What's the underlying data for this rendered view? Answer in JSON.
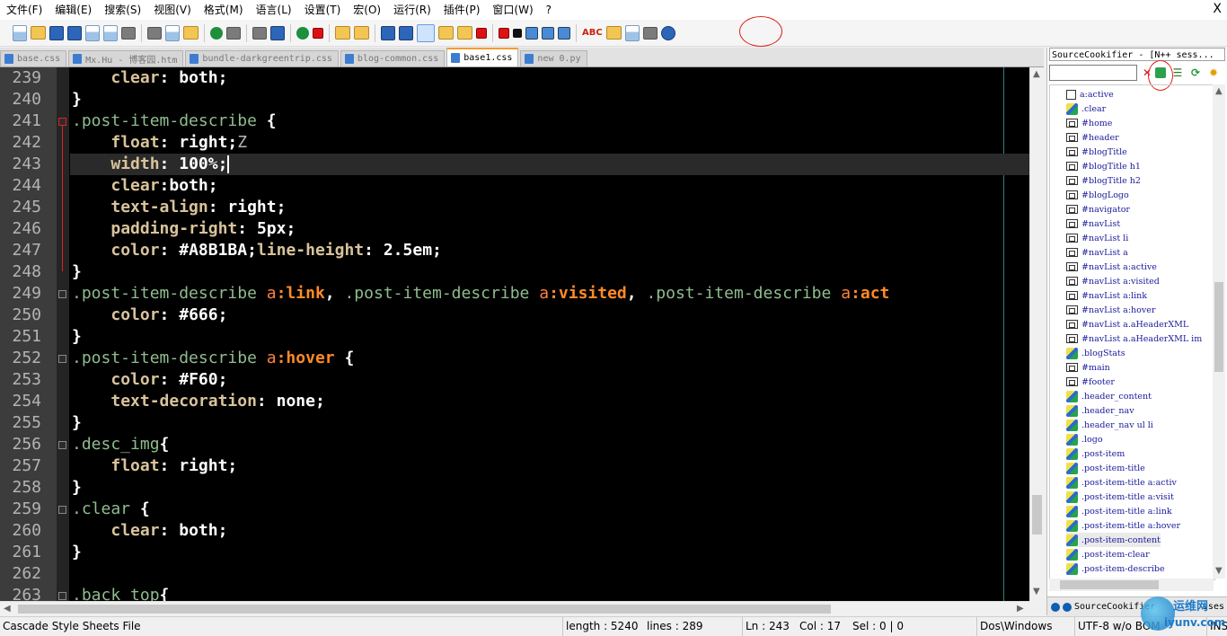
{
  "menu": [
    "文件(F)",
    "编辑(E)",
    "搜索(S)",
    "视图(V)",
    "格式(M)",
    "语言(L)",
    "设置(T)",
    "宏(O)",
    "运行(R)",
    "插件(P)",
    "窗口(W)",
    "?"
  ],
  "menu_close": "X",
  "tabs": [
    {
      "label": "base.css",
      "active": false
    },
    {
      "label": "Mx.Hu - 博客园.htm",
      "active": false
    },
    {
      "label": "bundle-darkgreentrip.css",
      "active": false
    },
    {
      "label": "blog-common.css",
      "active": false
    },
    {
      "label": "base1.css",
      "active": true
    },
    {
      "label": "new  0.py",
      "active": false
    }
  ],
  "toolbar_spellcheck": "ABC",
  "editor": {
    "lines": [
      {
        "n": "239",
        "tokens": [
          [
            "    ",
            ""
          ],
          [
            "clear",
            "prop"
          ],
          [
            ": ",
            "punc"
          ],
          [
            "both",
            "val"
          ],
          [
            ";",
            "punc"
          ]
        ]
      },
      {
        "n": "240",
        "tokens": [
          [
            "}",
            "punc"
          ]
        ]
      },
      {
        "n": "241",
        "tokens": [
          [
            ".post-item-describe",
            "sel"
          ],
          [
            " {",
            "punc"
          ]
        ]
      },
      {
        "n": "242",
        "tokens": [
          [
            "    ",
            ""
          ],
          [
            "float",
            "prop"
          ],
          [
            ": ",
            "punc"
          ],
          [
            "right",
            "val"
          ],
          [
            ";",
            "punc"
          ],
          [
            "Z",
            "zw"
          ]
        ]
      },
      {
        "n": "243",
        "tokens": [
          [
            "    ",
            ""
          ],
          [
            "width",
            "prop"
          ],
          [
            ": ",
            "punc"
          ],
          [
            "100%",
            "val"
          ],
          [
            ";",
            "punc"
          ]
        ],
        "current": true
      },
      {
        "n": "244",
        "tokens": [
          [
            "    ",
            ""
          ],
          [
            "clear",
            "prop"
          ],
          [
            ":",
            "punc"
          ],
          [
            "both",
            "val"
          ],
          [
            ";",
            "punc"
          ]
        ]
      },
      {
        "n": "245",
        "tokens": [
          [
            "    ",
            ""
          ],
          [
            "text-align",
            "prop"
          ],
          [
            ": ",
            "punc"
          ],
          [
            "right",
            "val"
          ],
          [
            ";",
            "punc"
          ]
        ]
      },
      {
        "n": "246",
        "tokens": [
          [
            "    ",
            ""
          ],
          [
            "padding-right",
            "prop"
          ],
          [
            ": ",
            "punc"
          ],
          [
            "5px",
            "val"
          ],
          [
            ";",
            "punc"
          ]
        ]
      },
      {
        "n": "247",
        "tokens": [
          [
            "    ",
            ""
          ],
          [
            "color",
            "prop"
          ],
          [
            ": ",
            "punc"
          ],
          [
            "#A8B1BA",
            "val"
          ],
          [
            ";",
            "punc"
          ],
          [
            "line-height",
            "prop"
          ],
          [
            ": ",
            "punc"
          ],
          [
            "2.5em",
            "val"
          ],
          [
            ";",
            "punc"
          ]
        ]
      },
      {
        "n": "248",
        "tokens": [
          [
            "}",
            "punc"
          ]
        ]
      },
      {
        "n": "249",
        "tokens": [
          [
            ".post-item-describe ",
            "sel"
          ],
          [
            "a",
            "el"
          ],
          [
            ":link",
            "pseudo"
          ],
          [
            ", ",
            "punc"
          ],
          [
            ".post-item-describe ",
            "sel"
          ],
          [
            "a",
            "el"
          ],
          [
            ":visited",
            "pseudo"
          ],
          [
            ", ",
            "punc"
          ],
          [
            ".post-item-describe ",
            "sel"
          ],
          [
            "a",
            "el"
          ],
          [
            ":act",
            "pseudo"
          ]
        ]
      },
      {
        "n": "250",
        "tokens": [
          [
            "    ",
            ""
          ],
          [
            "color",
            "prop"
          ],
          [
            ": ",
            "punc"
          ],
          [
            "#666",
            "val"
          ],
          [
            ";",
            "punc"
          ]
        ]
      },
      {
        "n": "251",
        "tokens": [
          [
            "}",
            "punc"
          ]
        ]
      },
      {
        "n": "252",
        "tokens": [
          [
            ".post-item-describe ",
            "sel"
          ],
          [
            "a",
            "el"
          ],
          [
            ":hover",
            "pseudo"
          ],
          [
            " {",
            "punc"
          ]
        ]
      },
      {
        "n": "253",
        "tokens": [
          [
            "    ",
            ""
          ],
          [
            "color",
            "prop"
          ],
          [
            ": ",
            "punc"
          ],
          [
            "#F60",
            "val"
          ],
          [
            ";",
            "punc"
          ]
        ]
      },
      {
        "n": "254",
        "tokens": [
          [
            "    ",
            ""
          ],
          [
            "text-decoration",
            "prop"
          ],
          [
            ": ",
            "punc"
          ],
          [
            "none",
            "val"
          ],
          [
            ";",
            "punc"
          ]
        ]
      },
      {
        "n": "255",
        "tokens": [
          [
            "}",
            "punc"
          ]
        ]
      },
      {
        "n": "256",
        "tokens": [
          [
            ".desc_img",
            "sel"
          ],
          [
            "{",
            "punc"
          ]
        ]
      },
      {
        "n": "257",
        "tokens": [
          [
            "    ",
            ""
          ],
          [
            "float",
            "prop"
          ],
          [
            ": ",
            "punc"
          ],
          [
            "right",
            "val"
          ],
          [
            ";",
            "punc"
          ]
        ]
      },
      {
        "n": "258",
        "tokens": [
          [
            "}",
            "punc"
          ]
        ]
      },
      {
        "n": "259",
        "tokens": [
          [
            ".clear",
            "sel"
          ],
          [
            " {",
            "punc"
          ]
        ]
      },
      {
        "n": "260",
        "tokens": [
          [
            "    ",
            ""
          ],
          [
            "clear",
            "prop"
          ],
          [
            ": ",
            "punc"
          ],
          [
            "both",
            "val"
          ],
          [
            ";",
            "punc"
          ]
        ]
      },
      {
        "n": "261",
        "tokens": [
          [
            "}",
            "punc"
          ]
        ]
      },
      {
        "n": "262",
        "tokens": []
      },
      {
        "n": "263",
        "tokens": [
          [
            ".back_top",
            "sel"
          ],
          [
            "{",
            "punc"
          ]
        ]
      }
    ]
  },
  "panel": {
    "title": "SourceCookifier - [N++ sess...",
    "close": "✕",
    "items": [
      {
        "label": "a:active",
        "icon": "box"
      },
      {
        "label": ".clear",
        "icon": "cls"
      },
      {
        "label": "#home",
        "icon": "hash"
      },
      {
        "label": "#header",
        "icon": "hash"
      },
      {
        "label": "#blogTitle",
        "icon": "hash"
      },
      {
        "label": "#blogTitle h1",
        "icon": "hash"
      },
      {
        "label": "#blogTitle h2",
        "icon": "hash"
      },
      {
        "label": "#blogLogo",
        "icon": "hash"
      },
      {
        "label": "#navigator",
        "icon": "hash"
      },
      {
        "label": "#navList",
        "icon": "hash"
      },
      {
        "label": "#navList li",
        "icon": "hash"
      },
      {
        "label": "#navList a",
        "icon": "hash"
      },
      {
        "label": "#navList a:active",
        "icon": "hash"
      },
      {
        "label": "#navList a:visited",
        "icon": "hash"
      },
      {
        "label": "#navList a:link",
        "icon": "hash"
      },
      {
        "label": "#navList a:hover",
        "icon": "hash"
      },
      {
        "label": "#navList a.aHeaderXML",
        "icon": "hash"
      },
      {
        "label": "#navList a.aHeaderXML im",
        "icon": "hash"
      },
      {
        "label": ".blogStats",
        "icon": "cls"
      },
      {
        "label": "#main",
        "icon": "hash"
      },
      {
        "label": "#footer",
        "icon": "hash"
      },
      {
        "label": ".header_content",
        "icon": "cls"
      },
      {
        "label": ".header_nav",
        "icon": "cls"
      },
      {
        "label": ".header_nav ul li",
        "icon": "cls"
      },
      {
        "label": ".logo",
        "icon": "cls"
      },
      {
        "label": ".post-item",
        "icon": "cls"
      },
      {
        "label": ".post-item-title",
        "icon": "cls"
      },
      {
        "label": ".post-item-title a:activ",
        "icon": "cls"
      },
      {
        "label": ".post-item-title a:visit",
        "icon": "cls"
      },
      {
        "label": ".post-item-title a:link",
        "icon": "cls"
      },
      {
        "label": ".post-item-title a:hover",
        "icon": "cls"
      },
      {
        "label": ".post-item-content",
        "icon": "cls",
        "highlight": true
      },
      {
        "label": ".post-item-clear",
        "icon": "cls"
      },
      {
        "label": ".post-item-describe",
        "icon": "cls"
      }
    ],
    "bottom_tab": "SourceCookifier",
    "bottom_tab_tail": "sses"
  },
  "status": {
    "file_type": "Cascade Style Sheets File",
    "length": "length : 5240",
    "lines": "lines : 289",
    "ln": "Ln : 243",
    "col": "Col : 17",
    "sel": "Sel : 0 | 0",
    "eol": "Dos\\Windows",
    "encoding": "UTF-8 w/o BOM",
    "mode": "INS"
  },
  "watermark": {
    "line1": "运维网",
    "line2": "iyunv.com"
  }
}
